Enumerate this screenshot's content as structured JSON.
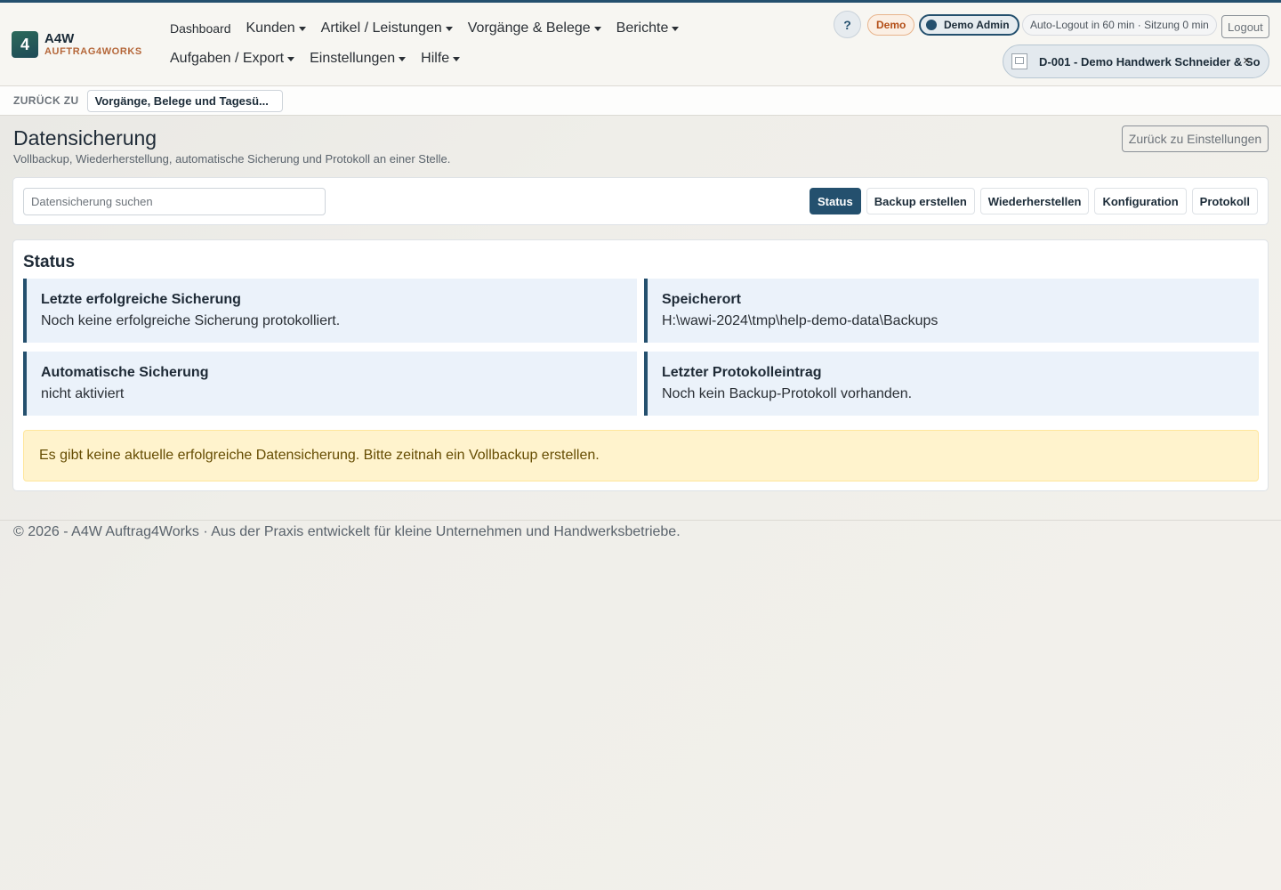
{
  "brand": {
    "logo_glyph": "4",
    "name": "A4W",
    "sub": "AUFTRAG4WORKS"
  },
  "nav": {
    "row1": [
      {
        "label": "Dashboard",
        "dropdown": false
      },
      {
        "label": "Kunden",
        "dropdown": true
      },
      {
        "label": "Artikel / Leistungen",
        "dropdown": true
      },
      {
        "label": "Vorgänge & Belege",
        "dropdown": true
      },
      {
        "label": "Berichte",
        "dropdown": true
      }
    ],
    "row2": [
      {
        "label": "Aufgaben / Export",
        "dropdown": true
      },
      {
        "label": "Einstellungen",
        "dropdown": true
      },
      {
        "label": "Hilfe",
        "dropdown": true
      }
    ]
  },
  "topright": {
    "help_label": "?",
    "demo_badge": "Demo",
    "user": "Demo Admin",
    "session": "Auto-Logout in 60 min · Sitzung 0 min",
    "logout": "Logout",
    "company": "D-001 - Demo Handwerk Schneider & So",
    "company_close": "✕"
  },
  "backbar": {
    "label": "ZURÜCK ZU",
    "link": "Vorgänge, Belege und Tagesü..."
  },
  "page": {
    "title": "Datensicherung",
    "subtitle": "Vollbackup, Wiederherstellung, automatische Sicherung und Protokoll an einer Stelle.",
    "back_button": "Zurück zu Einstellungen"
  },
  "search": {
    "placeholder": "Datensicherung suchen",
    "value": ""
  },
  "tabs": [
    "Status",
    "Backup erstellen",
    "Wiederherstellen",
    "Konfiguration",
    "Protokoll"
  ],
  "active_tab": "Status",
  "status": {
    "title": "Status",
    "boxes": [
      {
        "head": "Letzte erfolgreiche Sicherung",
        "value": "Noch keine erfolgreiche Sicherung protokolliert."
      },
      {
        "head": "Speicherort",
        "value": "H:\\wawi-2024\\tmp\\help-demo-data\\Backups"
      },
      {
        "head": "Automatische Sicherung",
        "value": "nicht aktiviert"
      },
      {
        "head": "Letzter Protokolleintrag",
        "value": "Noch kein Backup-Protokoll vorhanden."
      }
    ],
    "alert": "Es gibt keine aktuelle erfolgreiche Datensicherung. Bitte zeitnah ein Vollbackup erstellen."
  },
  "footer": "© 2026 - A4W Auftrag4Works · Aus der Praxis entwickelt für kleine Unternehmen und Handwerksbetriebe.",
  "colors": {
    "accent": "#24506e",
    "brand_orange": "#b5673a",
    "info_bg": "#ebf2fa",
    "warning_bg": "#fff3cd"
  }
}
